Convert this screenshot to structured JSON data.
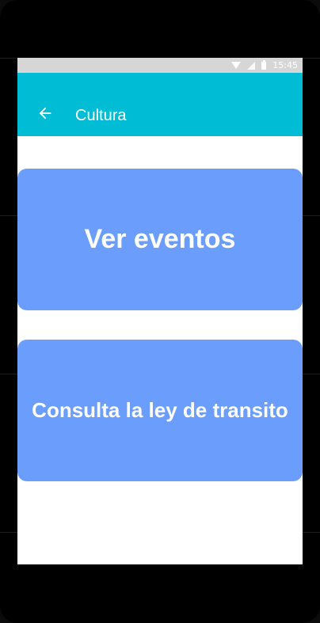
{
  "status_bar": {
    "time": "15:45",
    "icons": [
      "wifi-icon",
      "signal-icon",
      "battery-icon"
    ]
  },
  "app_bar": {
    "title": "Cultura",
    "back_icon": "arrow-back-icon",
    "background_color": "#00bcd4"
  },
  "actions": [
    {
      "label": "Ver eventos",
      "color": "#6b9dfc"
    },
    {
      "label": "Consulta la ley de transito",
      "color": "#6b9dfc"
    }
  ]
}
